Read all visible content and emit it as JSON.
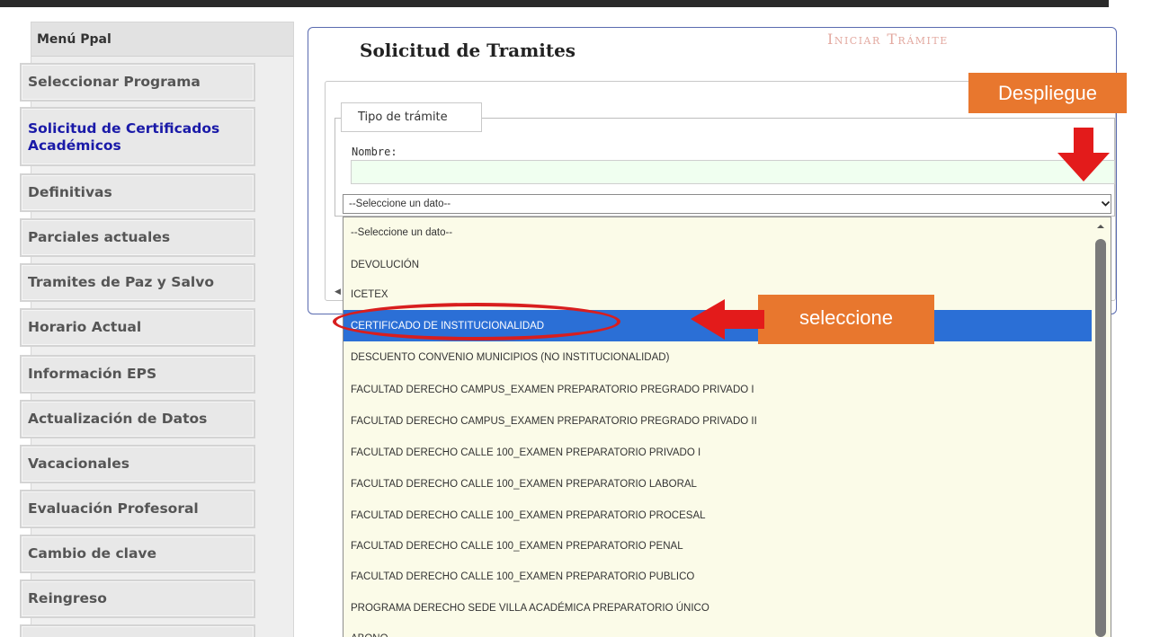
{
  "sidebar": {
    "header": "Menú Ppal",
    "items": [
      {
        "label": "Seleccionar Programa"
      },
      {
        "label": "Solicitud de Certificados Académicos"
      },
      {
        "label": "Definitivas"
      },
      {
        "label": "Parciales actuales"
      },
      {
        "label": "Tramites de Paz y Salvo"
      },
      {
        "label": "Horario Actual"
      },
      {
        "label": "Información EPS"
      },
      {
        "label": "Actualización de Datos"
      },
      {
        "label": "Vacacionales"
      },
      {
        "label": "Evaluación Profesoral"
      },
      {
        "label": "Cambio de clave"
      },
      {
        "label": "Reingreso"
      },
      {
        "label": ""
      }
    ]
  },
  "main": {
    "title": "Solicitud de Tramites",
    "iniciar_label": "Iniciar Trámite",
    "fieldset_legend": "Tipo de trámite",
    "nombre_label": "Nombre:",
    "nombre_value": "",
    "select_value": "--Seleccione un dato--"
  },
  "dropdown": {
    "options": [
      "--Seleccione un dato--",
      "DEVOLUCIÓN",
      "ICETEX",
      "CERTIFICADO DE INSTITUCIONALIDAD",
      "DESCUENTO CONVENIO MUNICIPIOS (NO INSTITUCIONALIDAD)",
      "FACULTAD DERECHO CAMPUS_EXAMEN PREPARATORIO PREGRADO PRIVADO I",
      "FACULTAD DERECHO CAMPUS_EXAMEN PREPARATORIO PREGRADO PRIVADO II",
      "FACULTAD DERECHO CALLE 100_EXAMEN PREPARATORIO PRIVADO I",
      "FACULTAD DERECHO CALLE 100_EXAMEN PREPARATORIO LABORAL",
      "FACULTAD DERECHO CALLE 100_EXAMEN PREPARATORIO PROCESAL",
      "FACULTAD DERECHO CALLE 100_EXAMEN PREPARATORIO PENAL",
      "FACULTAD DERECHO CALLE 100_EXAMEN PREPARATORIO PUBLICO",
      "PROGRAMA DERECHO SEDE VILLA ACADÉMICA PREPARATORIO ÚNICO",
      "ABONO"
    ],
    "selected_index": 3
  },
  "annotations": {
    "despliegue": "Despliegue",
    "seleccione": "seleccione",
    "color": "#e8772e",
    "arrow_color": "#e31b1b"
  },
  "colors": {
    "selected_option_bg": "#2b6fd6",
    "dropdown_bg": "#fbfbe8",
    "active_menu_text": "#1a1aa8"
  }
}
